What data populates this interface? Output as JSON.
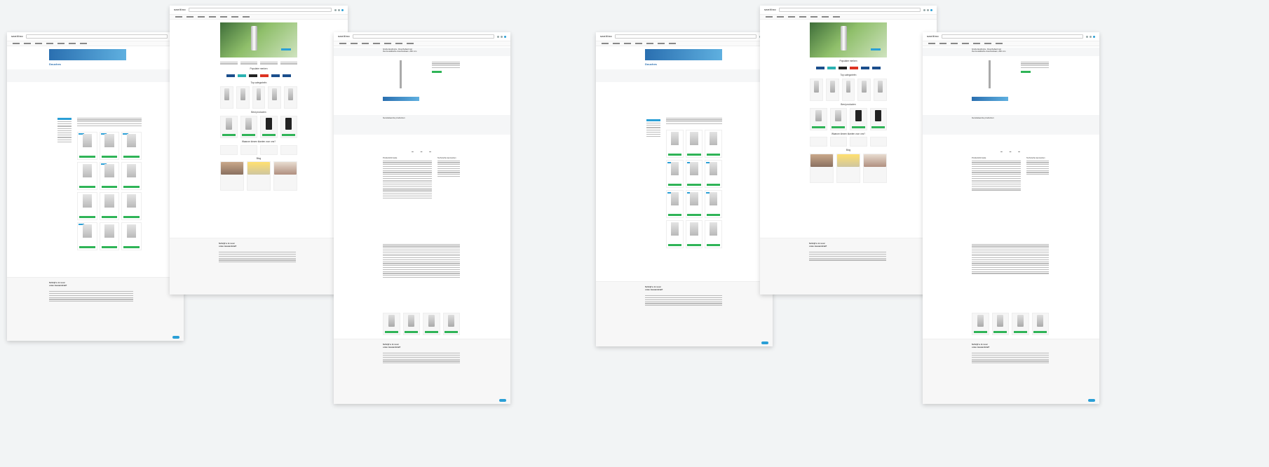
{
  "store": {
    "logo": "sanitino"
  },
  "headings": {
    "category_title": "Douches",
    "brands_title": "Populaire merken",
    "top_categories_title": "Top categorieën",
    "best_products_title": "Best producten",
    "reviews_title": "Waarom kiezen klanten voor ons?",
    "blog_title": "Blog",
    "related_title": "Gerelateerde producten",
    "newsletter_title": "Schrijf u in voor onze nieuwsbrief!",
    "product_title": "Grohe Euphoria - Douchebad met thermostatische douchekraan, 260 mm",
    "product_desc_title": "Productinformatie",
    "product_specs_title": "Technische kenmerken",
    "recent_title": "Recent bekeken"
  },
  "ui": {
    "add_to_cart": "In winkelwagen",
    "accent": "#2a9fd6",
    "green": "#2fb457"
  }
}
